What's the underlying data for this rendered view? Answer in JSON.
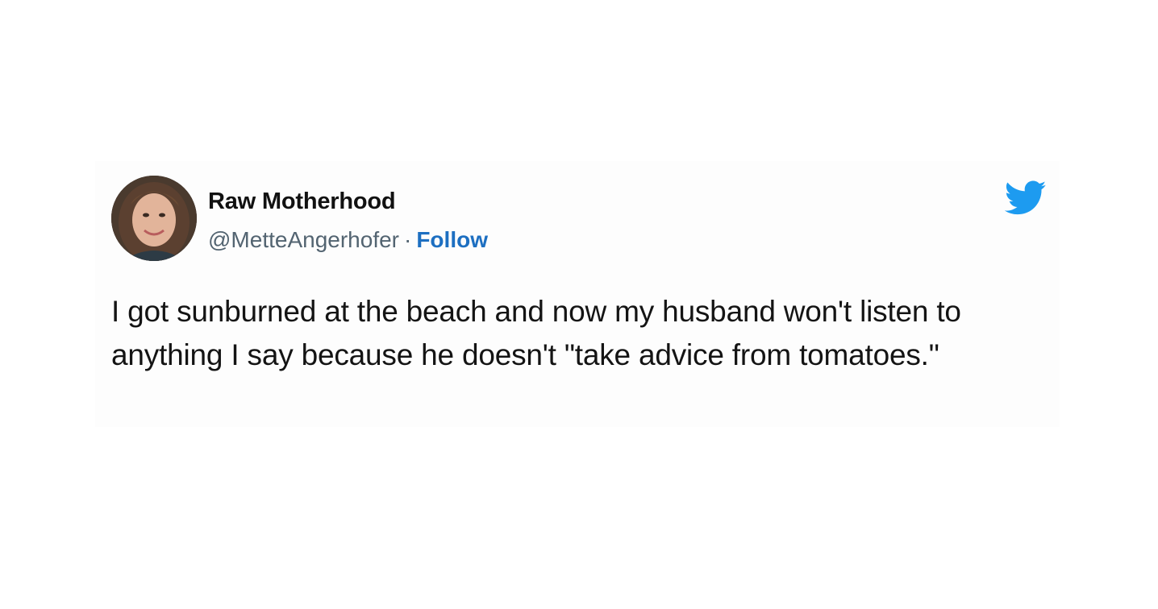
{
  "tweet": {
    "author_name": "Raw Motherhood",
    "handle": "@MetteAngerhofer",
    "separator": "·",
    "follow_label": "Follow",
    "text": "I got sunburned at the beach and now my husband won't listen to anything I say because he doesn't \"take advice from tomatoes.\"",
    "avatar_icon": "user-avatar-photo",
    "brand_icon": "twitter-bird-icon"
  },
  "colors": {
    "follow_link": "#1d6fc1",
    "twitter_blue": "#1d9bf0",
    "handle": "#536471",
    "text": "#141414"
  }
}
